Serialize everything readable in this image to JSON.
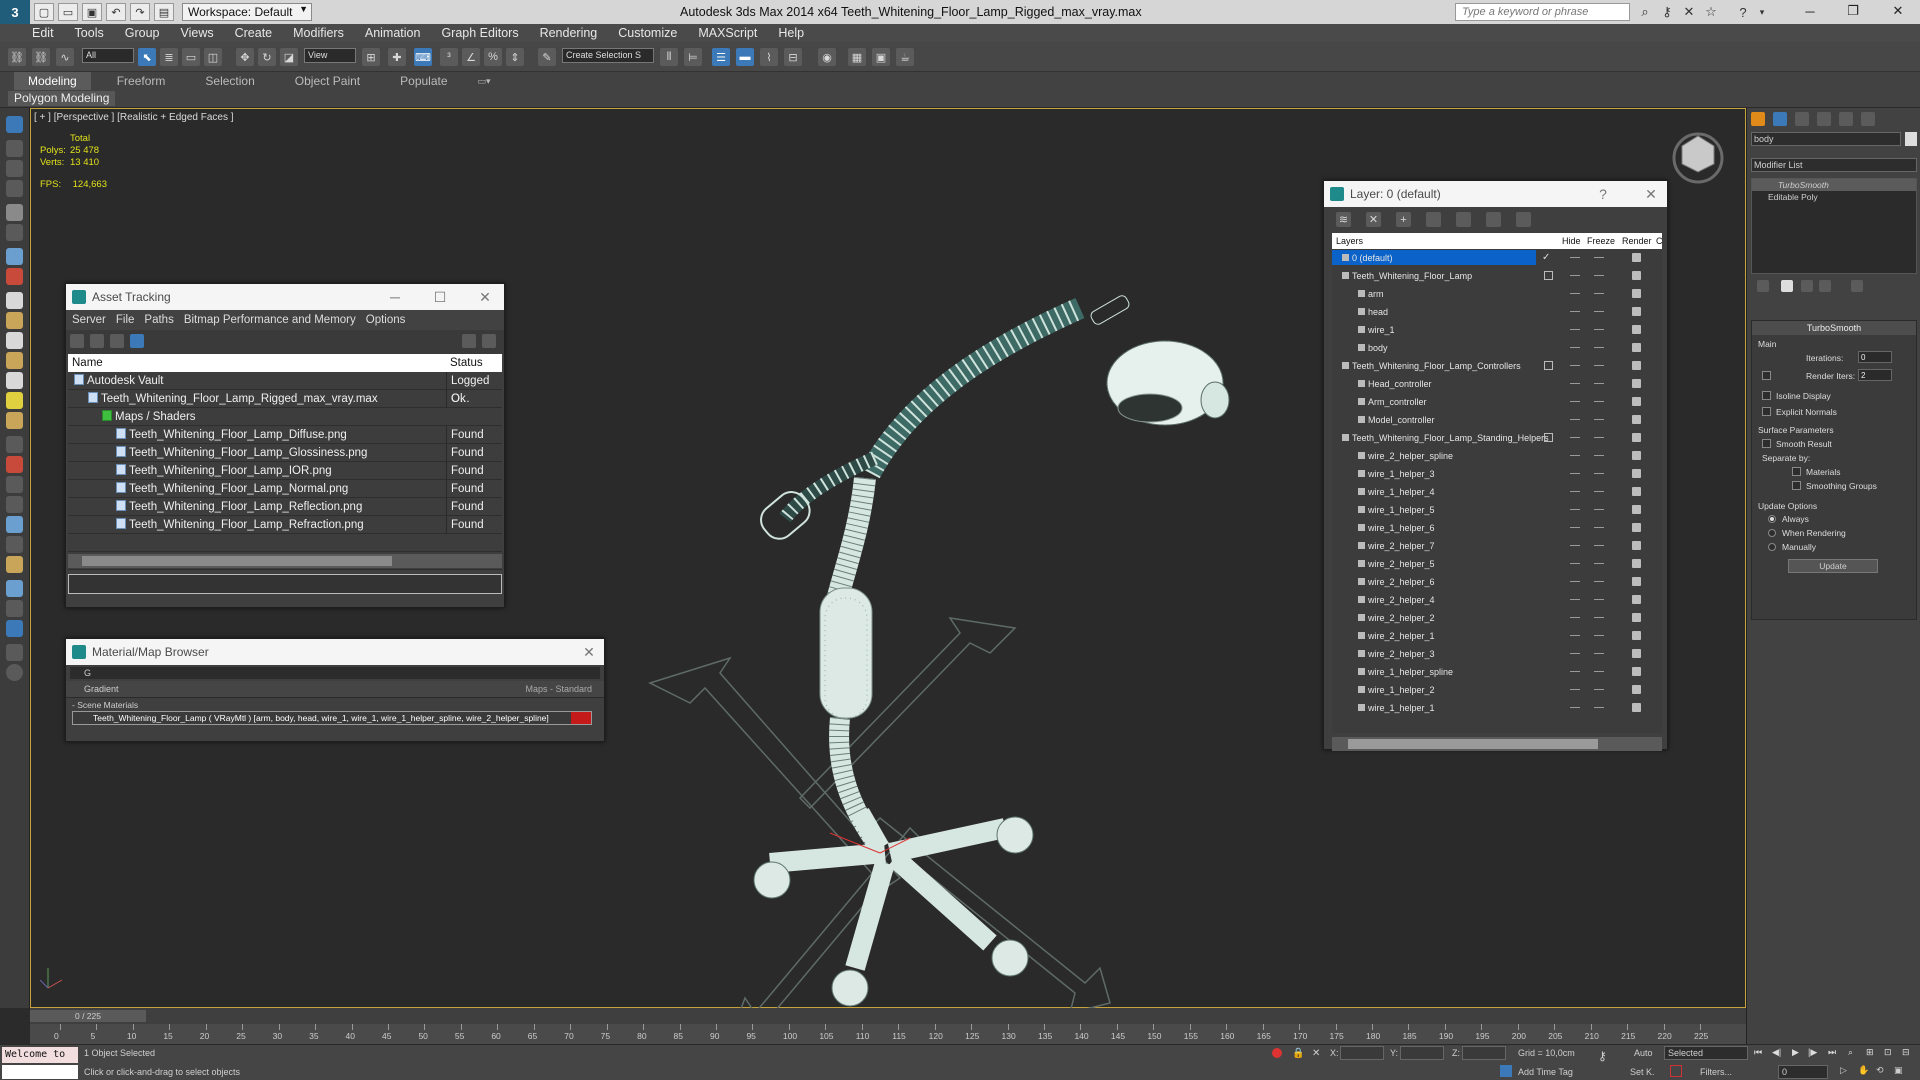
{
  "app": {
    "title": "Autodesk 3ds Max  2014 x64     Teeth_Whitening_Floor_Lamp_Rigged_max_vray.max",
    "workspace": "Workspace: Default",
    "search_placeholder": "Type a keyword or phrase",
    "logo_glyph": "3"
  },
  "menu": [
    "Edit",
    "Tools",
    "Group",
    "Views",
    "Create",
    "Modifiers",
    "Animation",
    "Graph Editors",
    "Rendering",
    "Customize",
    "MAXScript",
    "Help"
  ],
  "toolbar": {
    "filter_value": "All",
    "refcoord_value": "View",
    "named_selection_placeholder": "Create Selection S"
  },
  "ribbon": {
    "tabs": [
      "Modeling",
      "Freeform",
      "Selection",
      "Object Paint",
      "Populate"
    ],
    "active_tab": "Modeling",
    "sub_label": "Polygon Modeling"
  },
  "viewport": {
    "label": "[ + ] [Perspective ] [Realistic + Edged Faces ]",
    "stats_title": "Total",
    "polys_label": "Polys:",
    "polys_value": "25 478",
    "verts_label": "Verts:",
    "verts_value": "13 410",
    "fps_label": "FPS:",
    "fps_value": "124,663"
  },
  "asset_tracking": {
    "title": "Asset Tracking",
    "menu": [
      "Server",
      "File",
      "Paths",
      "Bitmap Performance and Memory",
      "Options"
    ],
    "col_name": "Name",
    "col_status": "Status",
    "rows": [
      {
        "name": "Autodesk Vault",
        "status": "Logged O...",
        "indent": 0
      },
      {
        "name": "Teeth_Whitening_Floor_Lamp_Rigged_max_vray.max",
        "status": "Ok",
        "indent": 1
      },
      {
        "name": "Maps / Shaders",
        "status": "",
        "indent": 2
      },
      {
        "name": "Teeth_Whitening_Floor_Lamp_Diffuse.png",
        "status": "Found",
        "indent": 3
      },
      {
        "name": "Teeth_Whitening_Floor_Lamp_Glossiness.png",
        "status": "Found",
        "indent": 3
      },
      {
        "name": "Teeth_Whitening_Floor_Lamp_IOR.png",
        "status": "Found",
        "indent": 3
      },
      {
        "name": "Teeth_Whitening_Floor_Lamp_Normal.png",
        "status": "Found",
        "indent": 3
      },
      {
        "name": "Teeth_Whitening_Floor_Lamp_Reflection.png",
        "status": "Found",
        "indent": 3
      },
      {
        "name": "Teeth_Whitening_Floor_Lamp_Refraction.png",
        "status": "Found",
        "indent": 3
      }
    ]
  },
  "material_browser": {
    "title": "Material/Map Browser",
    "search_value": "G",
    "gradient_label": "Gradient",
    "gradient_type": "Maps - Standard",
    "scene_materials": "- Scene Materials",
    "material_entry": "Teeth_Whitening_Floor_Lamp  ( VRayMtl ) [arm, body, head, wire_1, wire_1, wire_1_helper_spline, wire_2_helper_spline]"
  },
  "layer_window": {
    "title": "Layer: 0 (default)",
    "col_layers": "Layers",
    "col_hide": "Hide",
    "col_freeze": "Freeze",
    "col_render": "Render",
    "col_c": "C",
    "rows": [
      {
        "name": "0 (default)",
        "level": 0,
        "selected": true
      },
      {
        "name": "Teeth_Whitening_Floor_Lamp",
        "level": 0,
        "layer": true
      },
      {
        "name": "arm",
        "level": 1
      },
      {
        "name": "head",
        "level": 1
      },
      {
        "name": "wire_1",
        "level": 1
      },
      {
        "name": "body",
        "level": 1
      },
      {
        "name": "Teeth_Whitening_Floor_Lamp_Controllers",
        "level": 0,
        "layer": true
      },
      {
        "name": "Head_controller",
        "level": 1
      },
      {
        "name": "Arm_controller",
        "level": 1
      },
      {
        "name": "Model_controller",
        "level": 1
      },
      {
        "name": "Teeth_Whitening_Floor_Lamp_Standing_Helpers",
        "level": 0,
        "layer": true
      },
      {
        "name": "wire_2_helper_spline",
        "level": 1
      },
      {
        "name": "wire_1_helper_3",
        "level": 1
      },
      {
        "name": "wire_1_helper_4",
        "level": 1
      },
      {
        "name": "wire_1_helper_5",
        "level": 1
      },
      {
        "name": "wire_1_helper_6",
        "level": 1
      },
      {
        "name": "wire_2_helper_7",
        "level": 1
      },
      {
        "name": "wire_2_helper_5",
        "level": 1
      },
      {
        "name": "wire_2_helper_6",
        "level": 1
      },
      {
        "name": "wire_2_helper_4",
        "level": 1
      },
      {
        "name": "wire_2_helper_2",
        "level": 1
      },
      {
        "name": "wire_2_helper_1",
        "level": 1
      },
      {
        "name": "wire_2_helper_3",
        "level": 1
      },
      {
        "name": "wire_1_helper_spline",
        "level": 1
      },
      {
        "name": "wire_1_helper_2",
        "level": 1
      },
      {
        "name": "wire_1_helper_1",
        "level": 1
      }
    ]
  },
  "command_panel": {
    "object_name": "body",
    "modifier_list": "Modifier List",
    "stack": [
      "TurboSmooth",
      "Editable Poly"
    ],
    "turbosmooth_title": "TurboSmooth",
    "main_label": "Main",
    "iterations_label": "Iterations:",
    "iterations_value": "0",
    "render_iters_label": "Render Iters:",
    "render_iters_value": "2",
    "isoline_label": "Isoline Display",
    "explicit_label": "Explicit Normals",
    "surface_label": "Surface Parameters",
    "smooth_label": "Smooth Result",
    "separate_label": "Separate by:",
    "materials_label": "Materials",
    "smoothing_label": "Smoothing Groups",
    "update_label": "Update Options",
    "always_label": "Always",
    "when_rendering_label": "When Rendering",
    "manually_label": "Manually",
    "update_button": "Update"
  },
  "timeline": {
    "frame_counter": "0 / 225",
    "ticks": [
      "0",
      "5",
      "10",
      "15",
      "20",
      "25",
      "30",
      "35",
      "40",
      "45",
      "50",
      "55",
      "60",
      "65",
      "70",
      "75",
      "80",
      "85",
      "90",
      "95",
      "100",
      "105",
      "110",
      "115",
      "120",
      "125",
      "130",
      "135",
      "140",
      "145",
      "150",
      "155",
      "160",
      "165",
      "170",
      "175",
      "180",
      "185",
      "190",
      "195",
      "200",
      "205",
      "210",
      "215",
      "220",
      "225"
    ]
  },
  "status": {
    "welcome": "Welcome to",
    "selected": "1 Object Selected",
    "hint": "Click or click-and-drag to select objects",
    "x_label": "X:",
    "y_label": "Y:",
    "z_label": "Z:",
    "grid": "Grid = 10,0cm",
    "add_time_tag": "Add Time Tag",
    "auto": "Auto",
    "set_k": "Set K.",
    "selected_dd": "Selected",
    "filters": "Filters...",
    "frame": "0"
  },
  "colors": {
    "wire": "#cfe3dc",
    "viewport_border": "#c7a33b",
    "selection_blue": "#0b63c9",
    "stats_yellow": "#e2e21c"
  }
}
